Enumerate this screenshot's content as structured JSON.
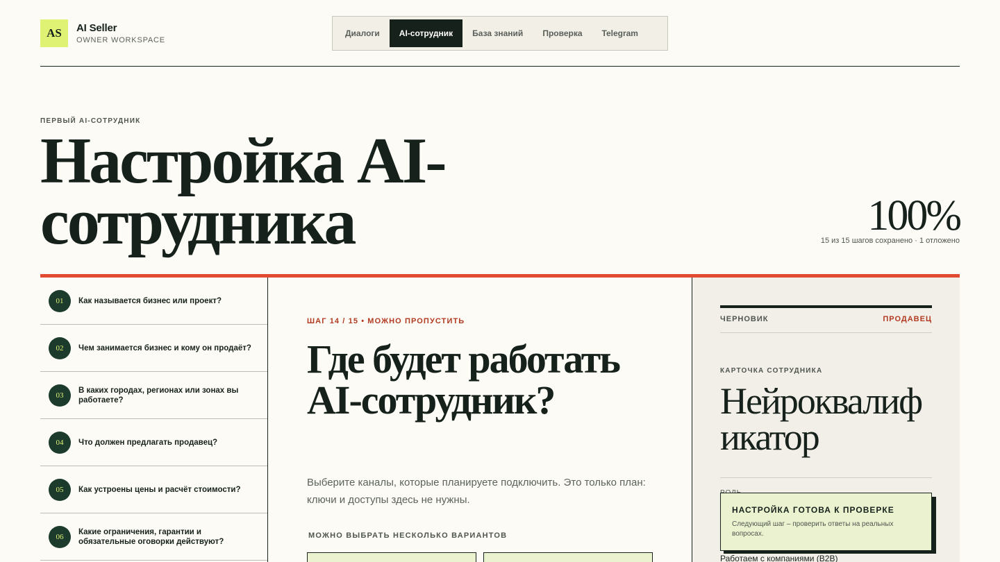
{
  "brand": {
    "logo": "AS",
    "title": "AI Seller",
    "subtitle": "OWNER WORKSPACE"
  },
  "nav": {
    "tabs": [
      {
        "label": "Диалоги",
        "active": false
      },
      {
        "label": "AI-сотрудник",
        "active": true
      },
      {
        "label": "База знаний",
        "active": false
      },
      {
        "label": "Проверка",
        "active": false
      },
      {
        "label": "Telegram",
        "active": false
      }
    ]
  },
  "hero": {
    "eyebrow": "ПЕРВЫЙ AI-СОТРУДНИК",
    "title": "Настройка AI-сотрудника",
    "progress_percent": "100%",
    "progress_note": "15 из 15 шагов сохранено · 1 отложено"
  },
  "steps": [
    {
      "num": "01",
      "label": "Как называется бизнес или проект?"
    },
    {
      "num": "02",
      "label": "Чем занимается бизнес и кому он продаёт?"
    },
    {
      "num": "03",
      "label": "В каких городах, регионах или зонах вы работаете?"
    },
    {
      "num": "04",
      "label": "Что должен предлагать продавец?"
    },
    {
      "num": "05",
      "label": "Как устроены цены и расчёт стоимости?"
    },
    {
      "num": "06",
      "label": "Какие ограничения, гарантии и обязательные оговорки действуют?"
    }
  ],
  "question": {
    "step_prefix": "ШАГ ",
    "step_current": "14 / 15",
    "step_suffix": " • МОЖНО ПРОПУСТИТЬ",
    "title": "Где будет работать AI-сотрудник?",
    "description": "Выберите каналы, которые планируете подключить. Это только план: ключи и доступы здесь не нужны.",
    "multi_label": "МОЖНО ВЫБРАТЬ НЕСКОЛЬКО ВАРИАНТОВ"
  },
  "card": {
    "draft_label": "ЧЕРНОВИК",
    "role_label": "ПРОДАВЕЦ",
    "card_label": "КАРТОЧКА СОТРУДНИКА",
    "name": "Нейроквалификатор",
    "field_label": "РОЛЬ",
    "field_value": "Работаем с компаниями (B2B)"
  },
  "toast": {
    "title": "НАСТРОЙКА ГОТОВА К ПРОВЕРКЕ",
    "text": "Следующий шаг – проверить ответы на реальных вопросах."
  },
  "colors": {
    "accent": "#e04a30",
    "lime": "#dff274",
    "dark_green": "#1c3b2d",
    "ink": "#17211c",
    "paper": "#fcfbf5"
  }
}
